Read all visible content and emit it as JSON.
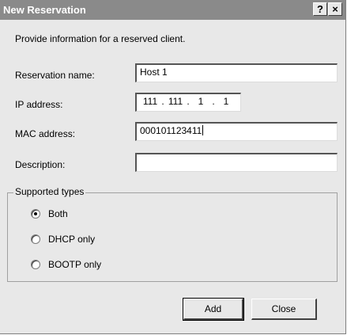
{
  "window": {
    "title": "New Reservation",
    "help_label": "?",
    "close_label": "×"
  },
  "intro_text": "Provide information for a reserved client.",
  "fields": {
    "reservation_name_label": "Reservation name:",
    "reservation_name_value": "Host 1",
    "ip_address_label": "IP address:",
    "ip_segments": [
      "111",
      "111",
      "1",
      "1"
    ],
    "ip_separator": ".",
    "mac_address_label": "MAC address:",
    "mac_address_value": "000101123411",
    "description_label": "Description:",
    "description_value": ""
  },
  "supported_types": {
    "legend": "Supported types",
    "options": [
      {
        "label": "Both",
        "selected": true
      },
      {
        "label": "DHCP only",
        "selected": false
      },
      {
        "label": "BOOTP only",
        "selected": false
      }
    ]
  },
  "buttons": {
    "add_label": "Add",
    "close_label": "Close"
  }
}
